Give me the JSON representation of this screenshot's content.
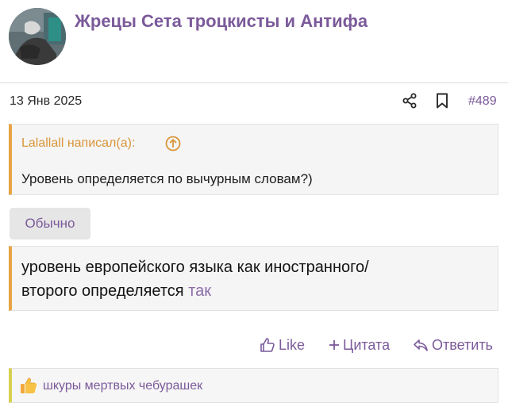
{
  "post": {
    "username": "Жрецы Сета троцкисты и Антифа",
    "date": "13 Янв 2025",
    "number": "#489"
  },
  "quote": {
    "author": "Lalallall написал(а):",
    "text": "Уровень определяется по вычурным словам?)"
  },
  "tag": {
    "label": "Обычно"
  },
  "message": {
    "text_line1": "уровень европейского языка как иностранного/",
    "text_line2": "второго определяется",
    "link_text": "так"
  },
  "actions": {
    "like": "Like",
    "quote": "Цитата",
    "reply": "Ответить"
  },
  "reactions": {
    "users": "шкуры мертвых чебурашек"
  },
  "colors": {
    "accent": "#7b5a9a",
    "quote_border": "#e8a444",
    "quote_author": "#d9953a",
    "reaction_border": "#d8d050"
  }
}
